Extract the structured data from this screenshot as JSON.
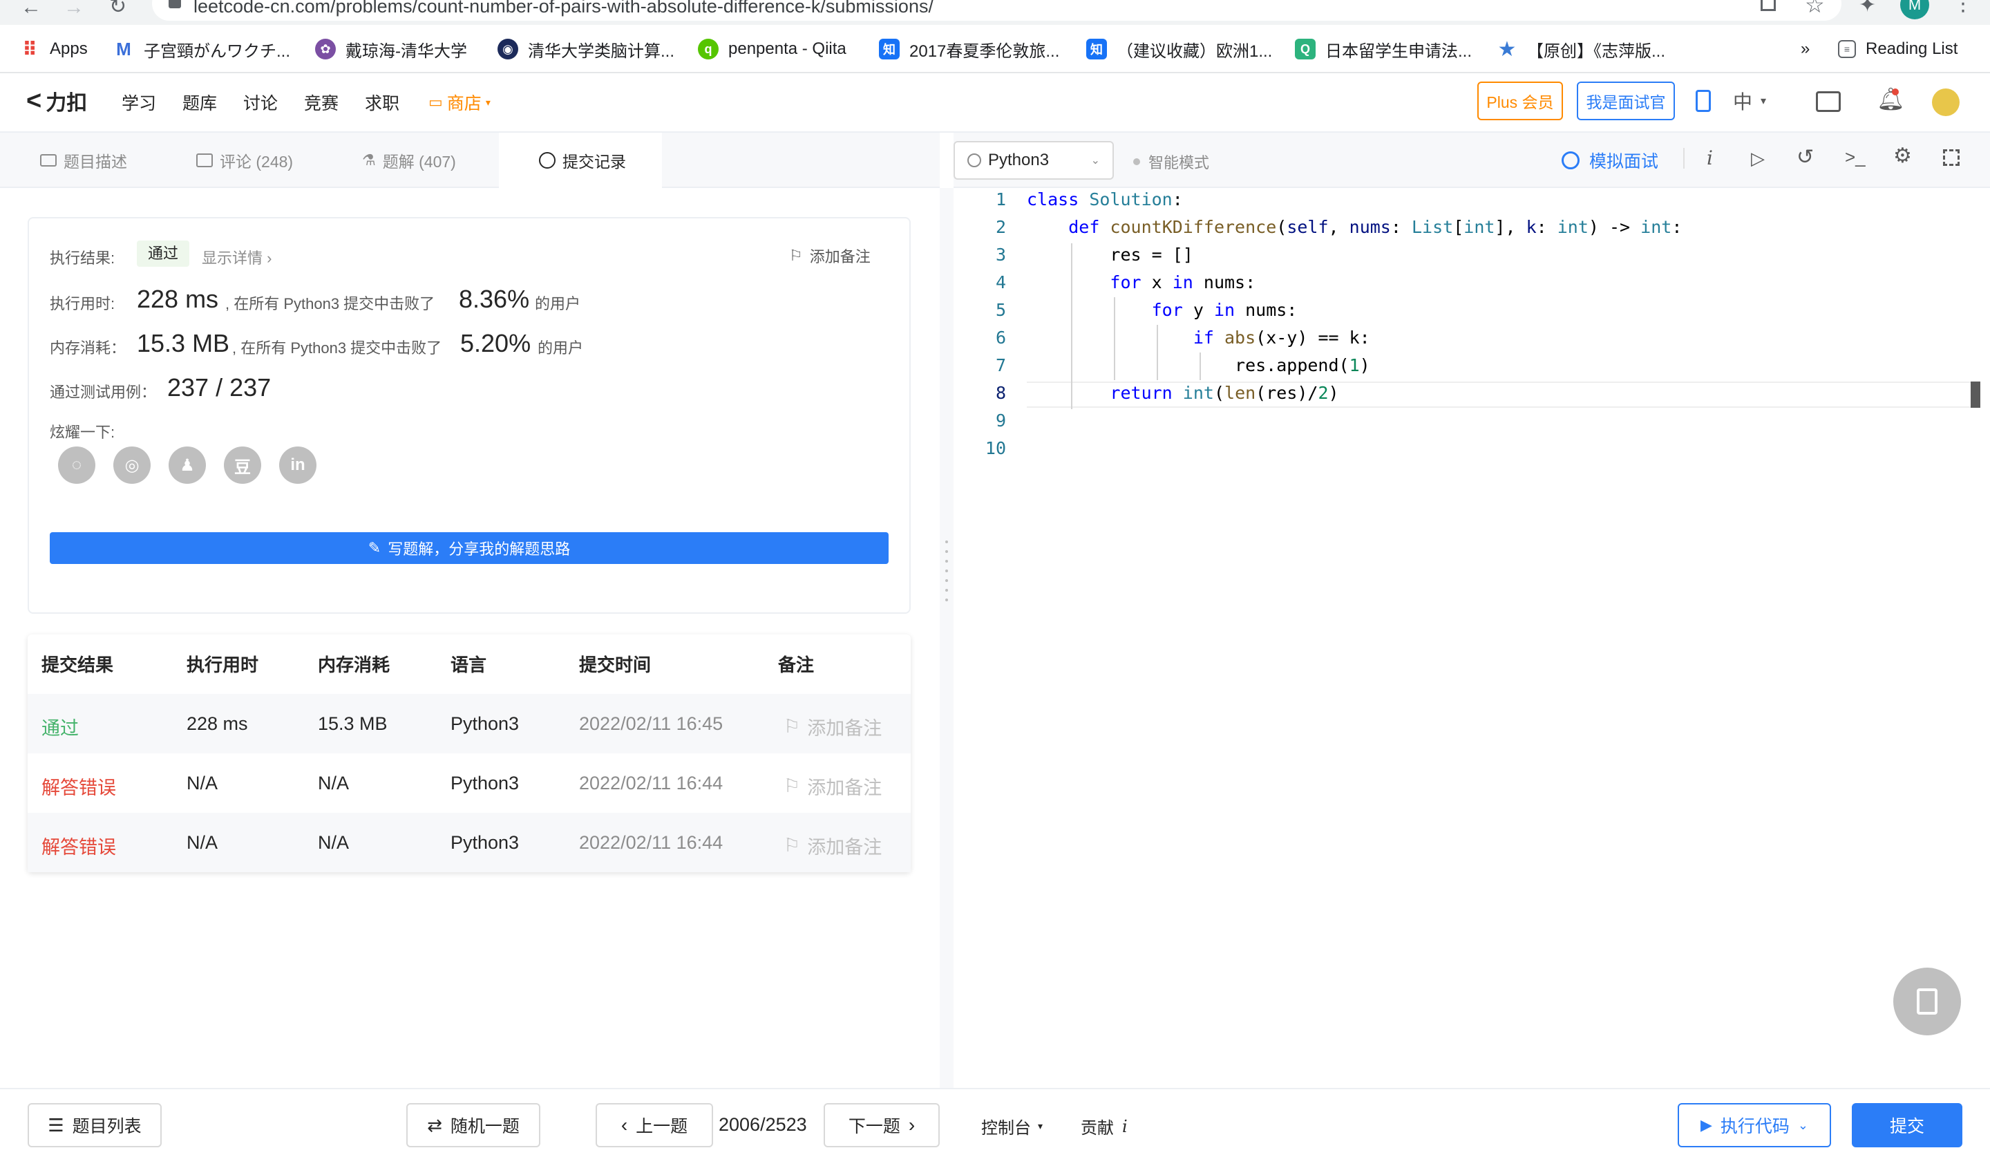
{
  "browser": {
    "url": "leetcode-cn.com/problems/count-number-of-pairs-with-absolute-difference-k/submissions/",
    "profile_initial": "M",
    "bookmarks": [
      {
        "label": "Apps",
        "icon": "apps-grid-icon"
      },
      {
        "label": "子宫頸がんワクチ...",
        "icon": "m-logo-icon"
      },
      {
        "label": "戴琼海-清华大学",
        "icon": "tsinghua-icon"
      },
      {
        "label": "清华大学类脑计算...",
        "icon": "eye-icon"
      },
      {
        "label": "penpenta - Qiita",
        "icon": "qiita-icon"
      },
      {
        "label": "2017春夏季伦敦旅...",
        "icon": "zhihu-icon"
      },
      {
        "label": "（建议收藏）欧洲1...",
        "icon": "zhihu-icon"
      },
      {
        "label": "日本留学生申请法...",
        "icon": "q-icon"
      },
      {
        "label": "【原创】《志萍版...",
        "icon": "star-icon"
      }
    ],
    "more": "»",
    "reading_list": "Reading List"
  },
  "header": {
    "logo": "力扣",
    "nav": [
      "学习",
      "题库",
      "讨论",
      "竞赛",
      "求职"
    ],
    "shop": "商店",
    "plus": "Plus 会员",
    "interviewer": "我是面试官",
    "lang": "中"
  },
  "tabs": {
    "description": "题目描述",
    "comments": "评论 (248)",
    "solutions": "题解 (407)",
    "submissions": "提交记录"
  },
  "editor_toolbar": {
    "language": "Python3",
    "smart_mode": "智能模式",
    "mock_interview": "模拟面试"
  },
  "result": {
    "status_label": "执行结果:",
    "status": "通过",
    "details": "显示详情 ›",
    "add_note": "添加备注",
    "runtime_label": "执行用时:",
    "runtime": "228 ms",
    "runtime_mid": ", 在所有 Python3 提交中击败了",
    "runtime_pct": "8.36%",
    "users": "的用户",
    "memory_label": "内存消耗：",
    "memory": "15.3 MB",
    "memory_mid": ", 在所有 Python3 提交中击败了",
    "memory_pct": "5.20%",
    "tests_label": "通过测试用例：",
    "tests": "237 / 237",
    "share_label": "炫耀一下:",
    "share_icons": [
      "wechat-icon",
      "weibo-icon",
      "qq-icon",
      "douban-icon",
      "linkedin-icon"
    ],
    "write_solution": "写题解，分享我的解题思路"
  },
  "submissions": {
    "headers": [
      "提交结果",
      "执行用时",
      "内存消耗",
      "语言",
      "提交时间",
      "备注"
    ],
    "rows": [
      {
        "status": "通过",
        "runtime": "228 ms",
        "memory": "15.3 MB",
        "lang": "Python3",
        "time": "2022/02/11 16:45",
        "note": "添加备注"
      },
      {
        "status": "解答错误",
        "runtime": "N/A",
        "memory": "N/A",
        "lang": "Python3",
        "time": "2022/02/11 16:44",
        "note": "添加备注"
      },
      {
        "status": "解答错误",
        "runtime": "N/A",
        "memory": "N/A",
        "lang": "Python3",
        "time": "2022/02/11 16:44",
        "note": "添加备注"
      }
    ]
  },
  "code": {
    "line_numbers": [
      "1",
      "2",
      "3",
      "4",
      "5",
      "6",
      "7",
      "8",
      "9",
      "10"
    ]
  },
  "bottom": {
    "problem_list": "题目列表",
    "random": "随机一题",
    "prev": "上一题",
    "page": "2006/2523",
    "next": "下一题",
    "console": "控制台",
    "contribute": "贡献",
    "run": "执行代码",
    "submit": "提交"
  },
  "colors": {
    "accent": "#2b7df7",
    "pass": "#45b36b",
    "wrong": "#e5493a",
    "shop": "#ff8a00"
  }
}
